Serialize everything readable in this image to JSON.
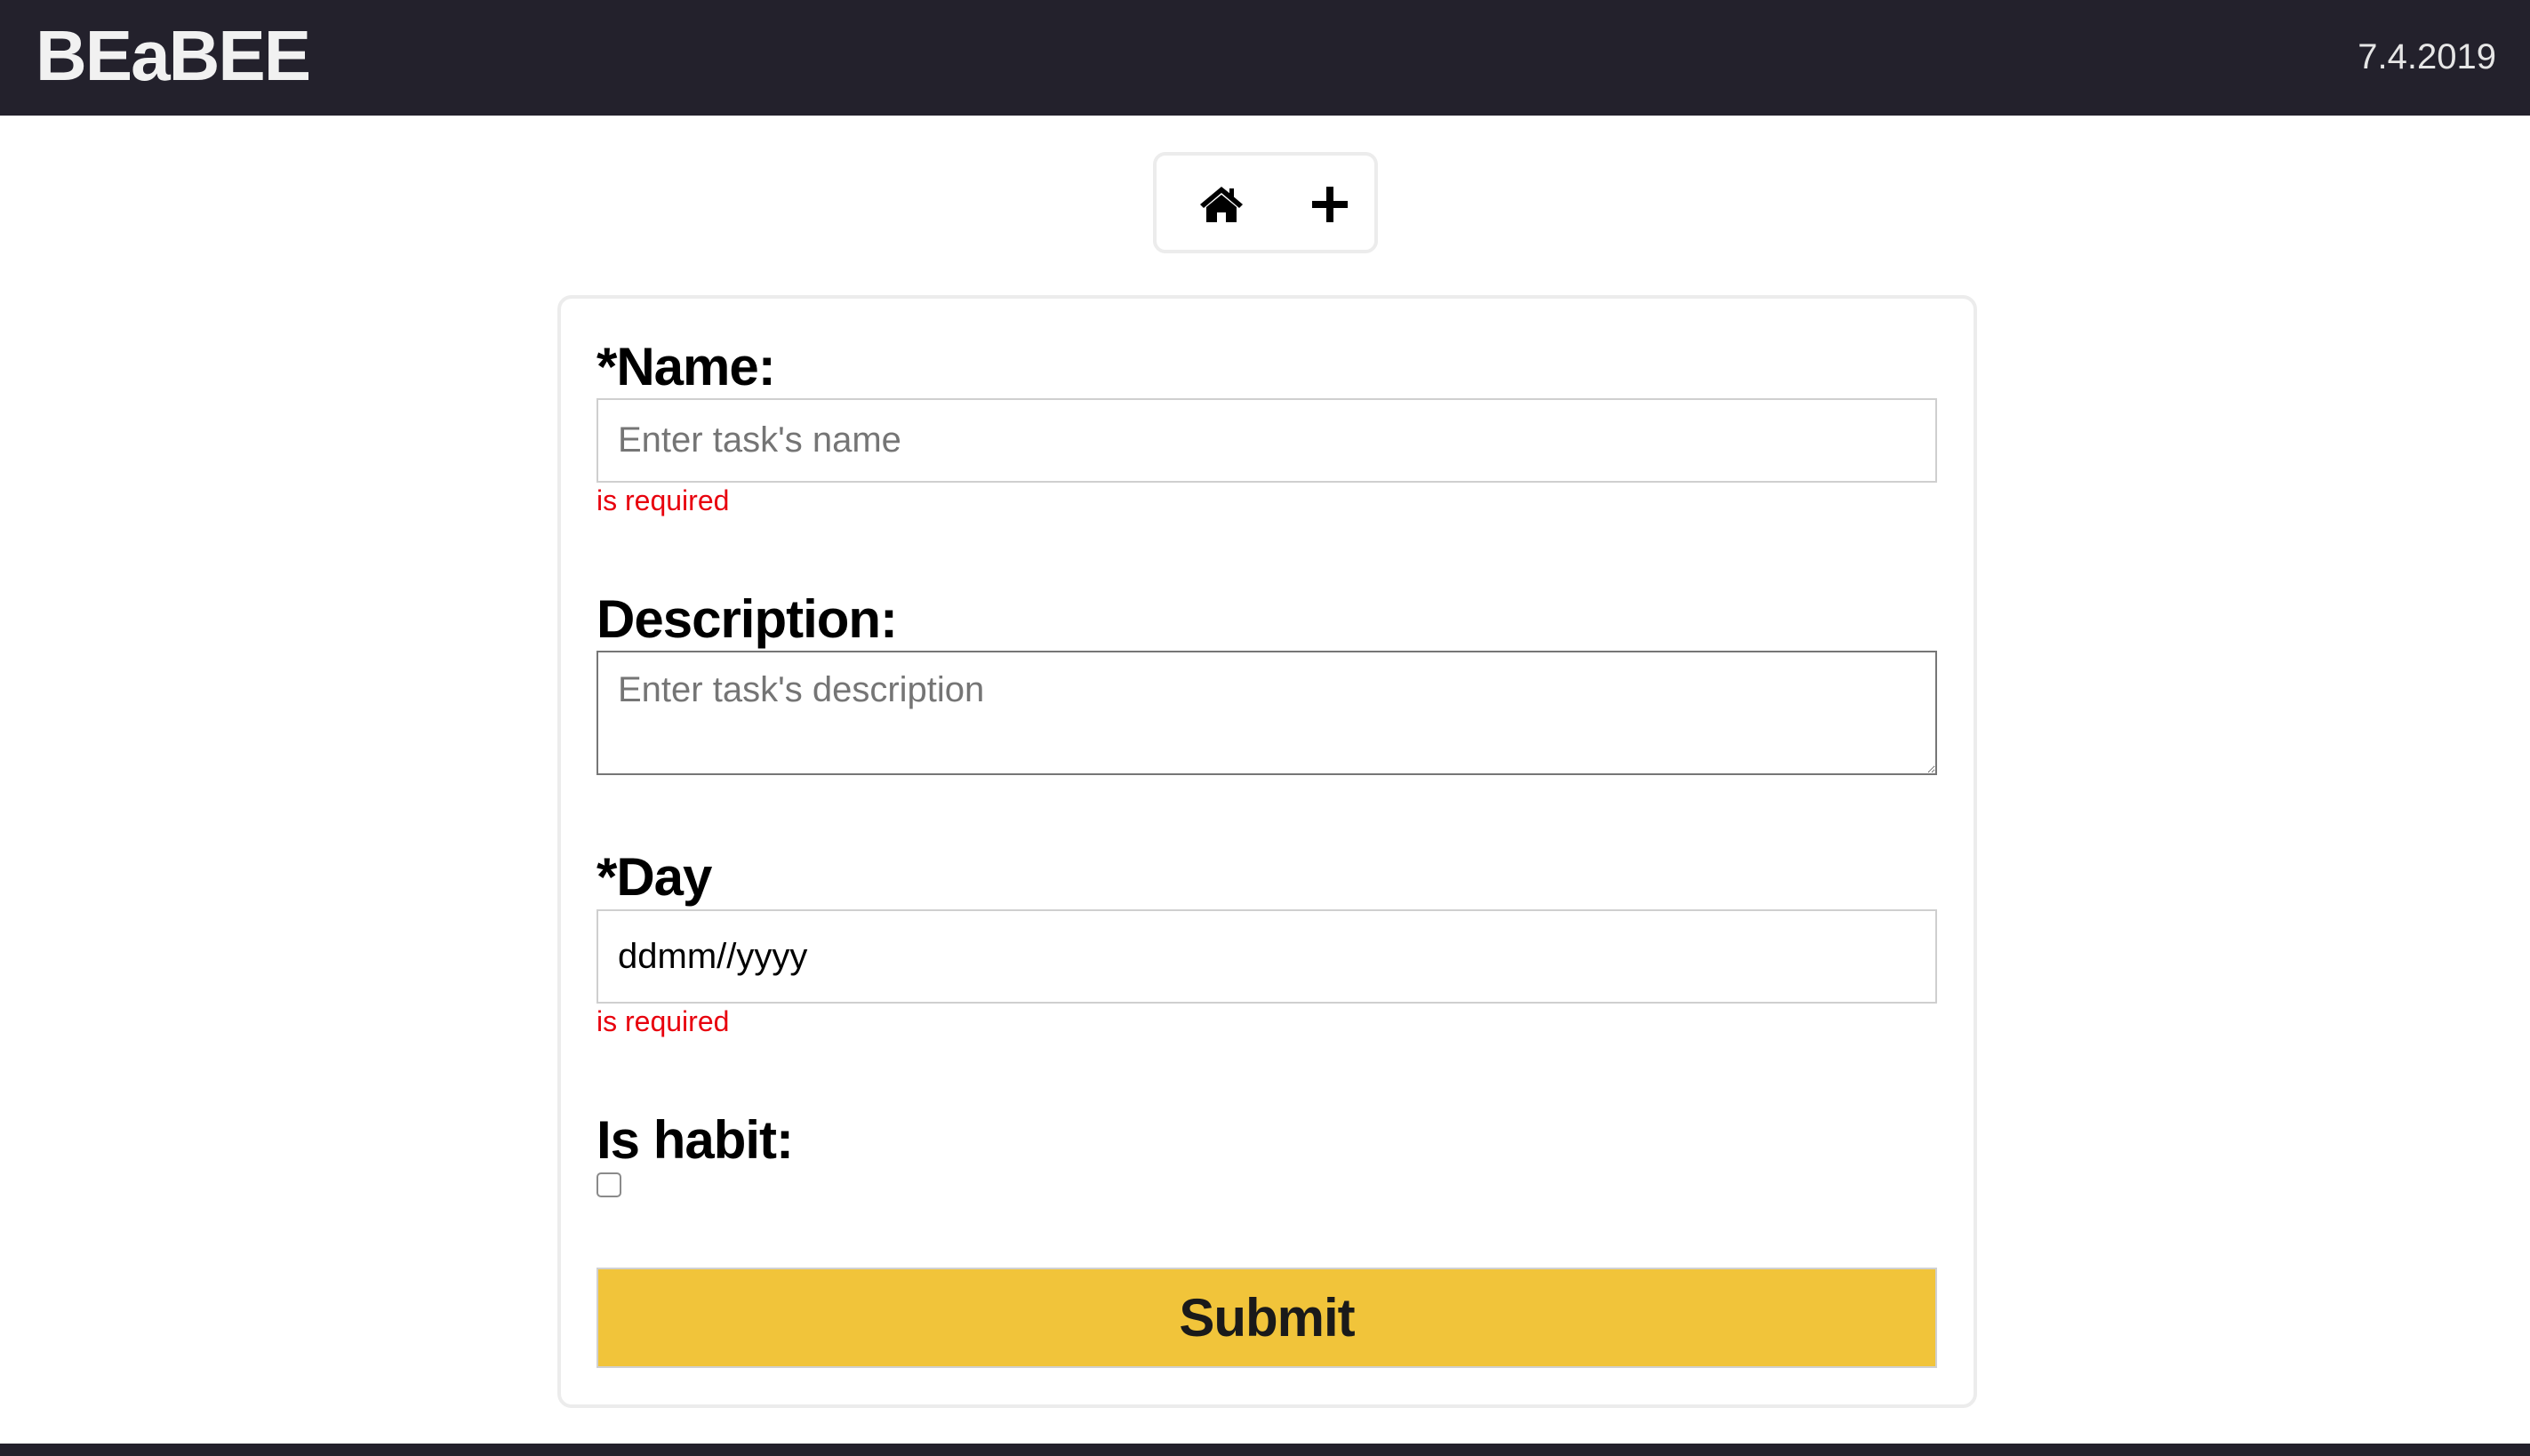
{
  "header": {
    "brand": "BEaBEE",
    "date": "7.4.2019"
  },
  "nav": {
    "home_icon": "home-icon",
    "add_icon": "plus-icon"
  },
  "form": {
    "name": {
      "label": "*Name:",
      "placeholder": "Enter task's name",
      "value": "",
      "error": "is required"
    },
    "description": {
      "label": "Description:",
      "placeholder": "Enter task's description",
      "value": ""
    },
    "day": {
      "label": "*Day",
      "display": "ddmm//yyyy",
      "error": "is required"
    },
    "habit": {
      "label": "Is habit:",
      "checked": false
    },
    "submit_label": "Submit"
  },
  "colors": {
    "header_bg": "#23212c",
    "accent": "#f1c43a",
    "error": "#e8000d"
  }
}
